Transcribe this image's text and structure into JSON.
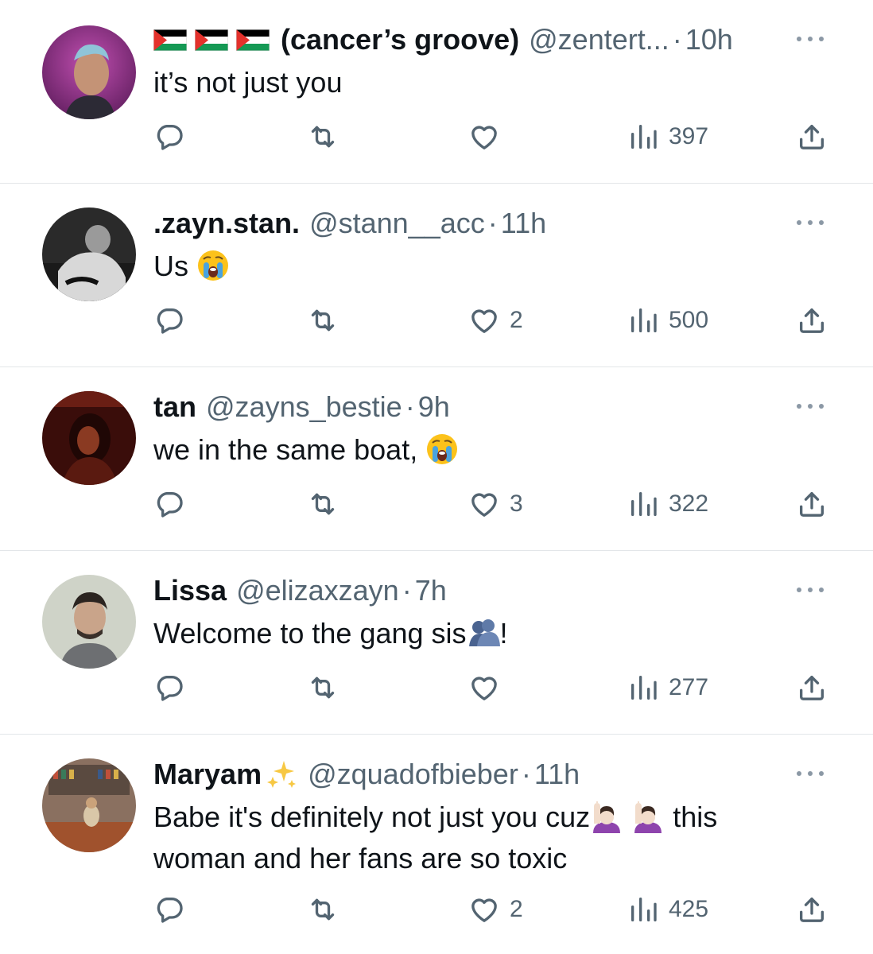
{
  "tweets": [
    {
      "name": "(cancer’s groove)",
      "handle": "@zentert...",
      "time": "10h",
      "text": "it’s not just you",
      "likes": "",
      "views": "397"
    },
    {
      "name": ".zayn.stan.",
      "handle": "@stann__acc",
      "time": "11h",
      "text_a": "Us",
      "likes": "2",
      "views": "500"
    },
    {
      "name": "tan",
      "handle": "@zayns_bestie",
      "time": "9h",
      "text_a": "we in the same boat, ",
      "likes": "3",
      "views": "322"
    },
    {
      "name": "Lissa",
      "handle": "@elizaxzayn",
      "time": "7h",
      "text_a": "Welcome to the gang sis",
      "text_b": "!",
      "likes": "",
      "views": "277"
    },
    {
      "name": "Maryam",
      "handle": "@zquadofbieber",
      "time": "11h",
      "text_a": "Babe it's definitely not just you cuz",
      "text_b": "this",
      "text_c": "woman and her fans are so toxic",
      "likes": "2",
      "views": "425"
    }
  ],
  "separator": "·",
  "icons": {
    "reply": "reply-icon",
    "retweet": "retweet-icon",
    "like": "heart-icon",
    "views": "views-icon",
    "share": "share-icon",
    "more": "more-icon"
  },
  "colors": {
    "text": "#0f1419",
    "secondary": "#536471",
    "divider": "#e3e6e9"
  }
}
